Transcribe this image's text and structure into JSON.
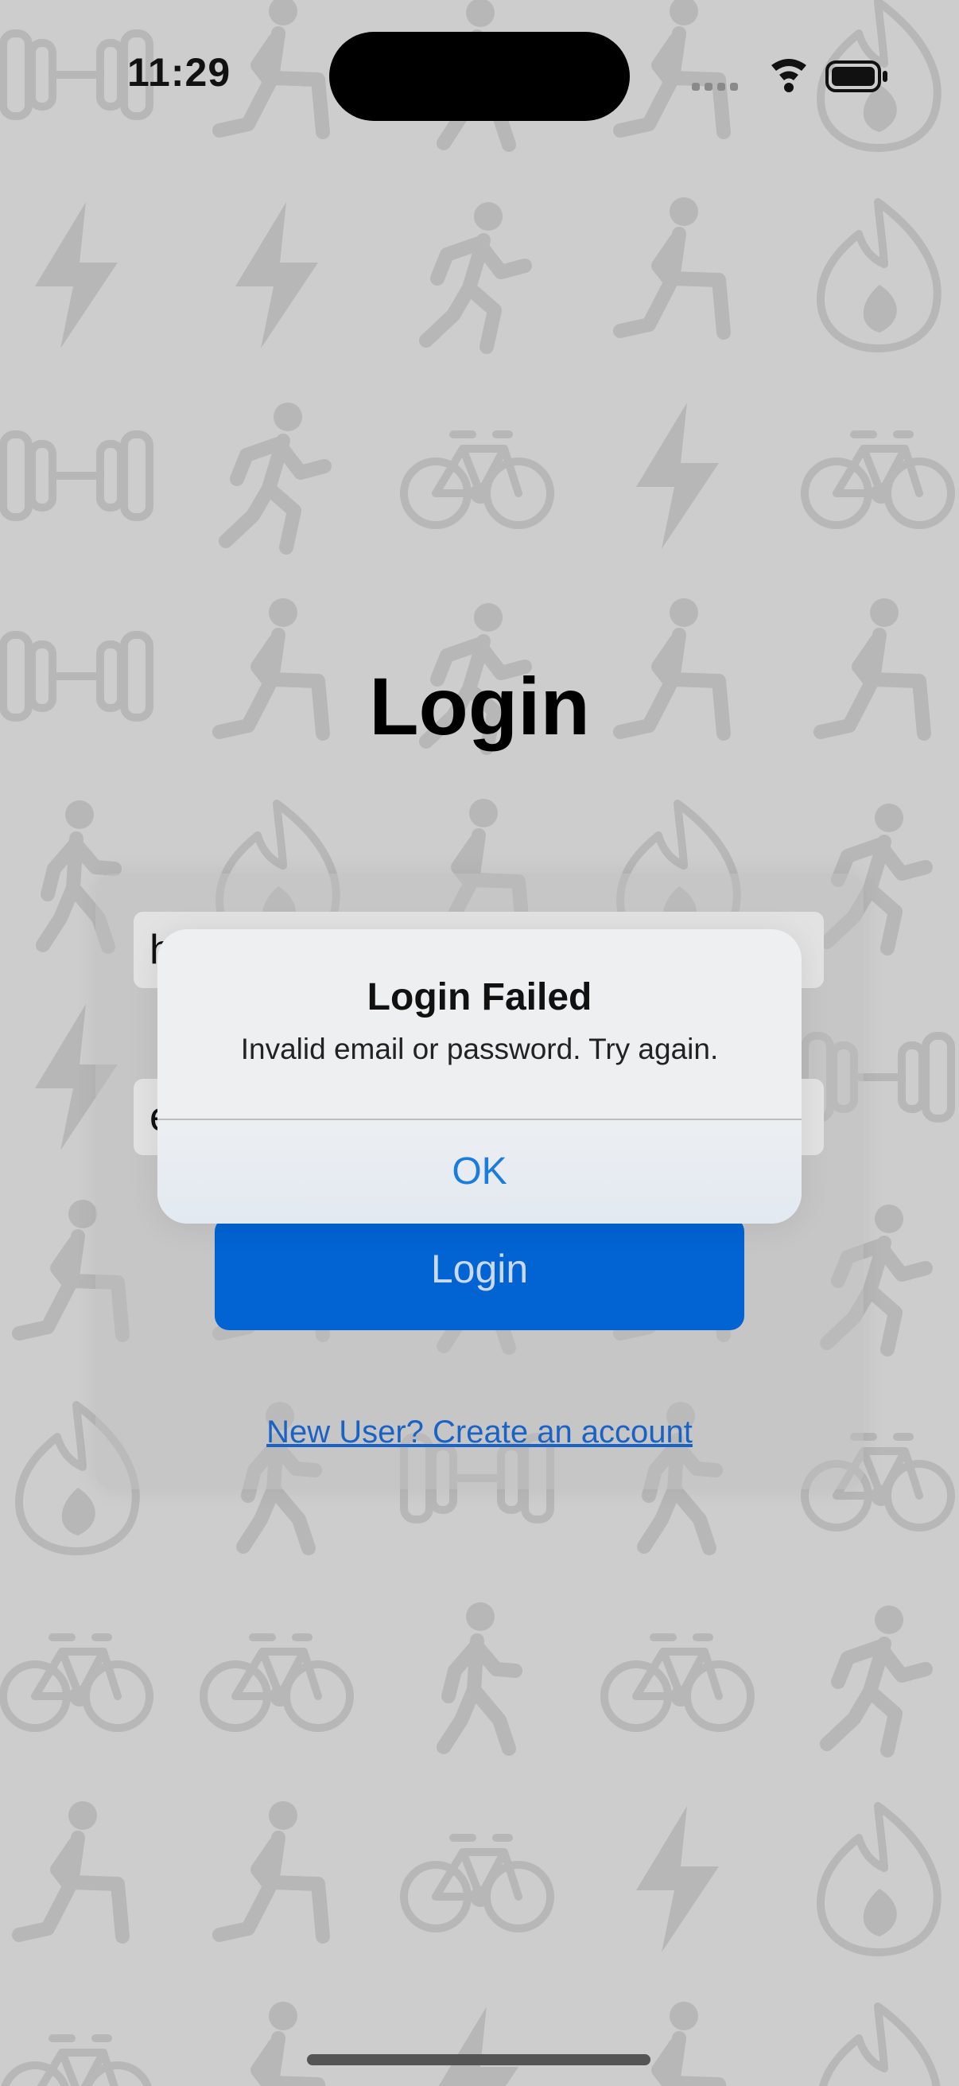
{
  "status_bar": {
    "time": "11:29",
    "icons": [
      "cellular-icon",
      "wifi-icon",
      "battery-icon"
    ]
  },
  "background": {
    "icon_color": "#b7b7b7",
    "icons": [
      "dumbbell-icon",
      "runner-icon",
      "lunge-icon",
      "lightning-icon",
      "flame-icon",
      "bicycle-icon",
      "walking-icon"
    ]
  },
  "login": {
    "title": "Login",
    "email_value": "h",
    "password_value": "e",
    "button_label": "Login",
    "signup_link": "New User? Create an account"
  },
  "alert": {
    "title": "Login Failed",
    "message": "Invalid email or password. Try again.",
    "ok_label": "OK"
  },
  "colors": {
    "accent": "#0263d3",
    "link": "#1a63c4",
    "alert_button": "#1a7cde"
  }
}
